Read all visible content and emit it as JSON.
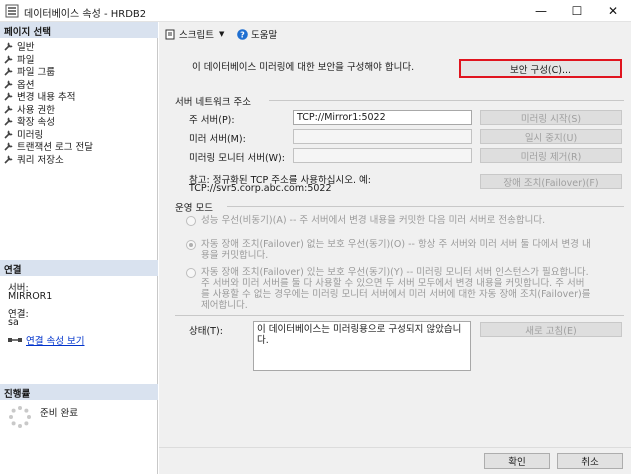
{
  "window": {
    "title": "데이터베이스 속성 - HRDB2",
    "minimize": "—",
    "maximize": "☐",
    "close": "✕"
  },
  "left": {
    "pages_header": "페이지 선택",
    "pages": [
      "일반",
      "파일",
      "파일 그룹",
      "옵션",
      "변경 내용 추적",
      "사용 권한",
      "확장 속성",
      "미러링",
      "트랜잭션 로그 전달",
      "쿼리 저장소"
    ],
    "connection_header": "연결",
    "server_label": "서버:",
    "server_value": "MIRROR1",
    "conn_label": "연결:",
    "conn_value": "sa",
    "conn_link": "연결 속성 보기",
    "progress_header": "진행률",
    "progress_status": "준비 완료"
  },
  "toolbar": {
    "script": "스크립트",
    "help": "도움말"
  },
  "main": {
    "intro": "이 데이터베이스 미러링에 대한 보안을 구성해야 합니다.",
    "configure_security": "보안 구성(C)...",
    "network_section": "서버 네트워크 주소",
    "principal_label": "주 서버(P):",
    "principal_value": "TCP://Mirror1:5022",
    "mirror_label": "미러 서버(M):",
    "mirror_value": "",
    "witness_label": "미러링 모니터 서버(W):",
    "witness_value": "",
    "start_mirroring": "미러링 시작(S)",
    "pause": "일시 중지(U)",
    "remove_mirroring": "미러링 제거(R)",
    "note": "참고: 정규화된 TCP 주소를 사용하십시오. 예:",
    "note_example": "TCP://svr5.corp.abc.com:5022",
    "failover": "장애 조치(Failover)(F)",
    "mode_section": "운영 모드",
    "mode_high_perf": "성능 우선(비동기)(A) -- 주 서버에서 변경 내용을 커밋한 다음 미러 서버로 전송합니다.",
    "mode_high_safety_1": "자동 장애 조치(Failover) 없는 보호 우선(동기)(O) -- 항상 주 서버와 미러 서버 둘 다에서 변경 내",
    "mode_high_safety_2": "용을 커밋합니다.",
    "mode_auto_1": "자동 장애 조치(Failover) 있는 보호 우선(동기)(Y) -- 미러링 모니터 서버 인스턴스가 필요합니다.",
    "mode_auto_2": "주 서버와 미러 서버를 둘 다 사용할 수 있으면 두 서버 모두에서 변경 내용을 커밋합니다. 주 서버",
    "mode_auto_3": "를 사용할 수 없는 경우에는 미러링 모니터 서버에서 미러 서버에 대한 자동 장애 조치(Failover)를",
    "mode_auto_4": "제어합니다.",
    "status_label": "상태(T):",
    "status_value": "이 데이터베이스는 미러링용으로 구성되지 않았습니다.",
    "refresh": "새로 고침(E)"
  },
  "footer": {
    "ok": "확인",
    "cancel": "취소"
  }
}
